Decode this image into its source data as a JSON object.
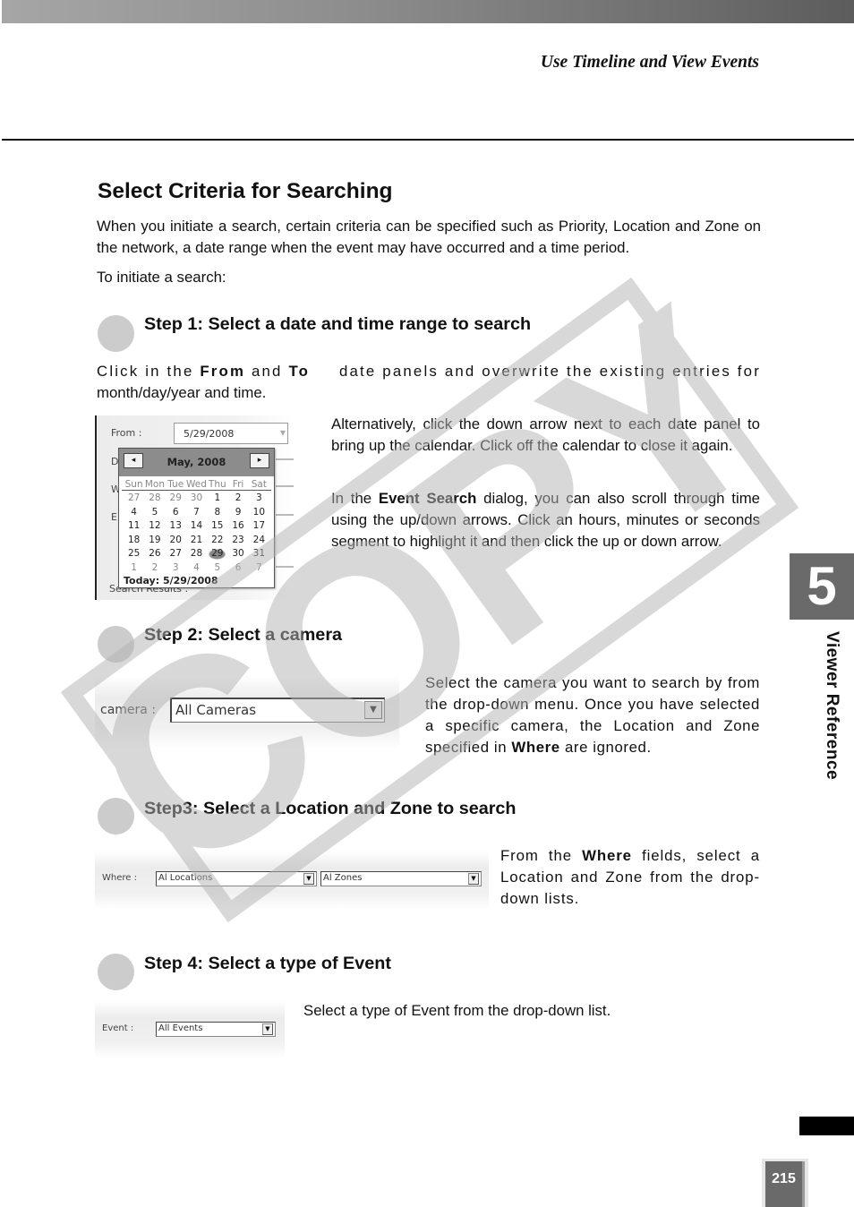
{
  "header": {
    "running_title": "Use Timeline and View Events"
  },
  "section": {
    "title": "Select Criteria for Searching",
    "intro": "When you initiate a search, certain criteria can be specified such as Priority, Location and Zone on the network, a date range when the event may have occurred and a time period.",
    "initiate": "To initiate a search:"
  },
  "steps": [
    {
      "title": "Step 1: Select a date and time range to search",
      "text_a_1": "Click in the ",
      "text_a_bold_1": "From",
      "text_a_2": " and ",
      "text_a_bold_2": "To",
      "text_a_3": " date panels and overwrite the existing entries for month/day/year and time.",
      "text_b": "Alternatively, click the down arrow next to each date panel to bring up the calendar. Click off the calendar to close it again.",
      "text_c_1": "In the ",
      "text_c_bold": "Event Search",
      "text_c_2": " dialog, you can also scroll through time using the up/down arrows. Click an hours, minutes or seconds segment to highlight it and then click the up or down arrow."
    },
    {
      "title": "Step 2: Select a camera",
      "text_1": "Select the camera you want to search by from the drop-down menu. Once you have selected a specific camera, the Location and Zone specified in ",
      "text_bold": "Where",
      "text_2": " are ignored."
    },
    {
      "title": "Step3: Select a Location and Zone to search",
      "text_1": "From the ",
      "text_bold": "Where",
      "text_2": " fields, select a Location and Zone from the drop-down lists."
    },
    {
      "title": "Step 4: Select a type of Event",
      "text": "Select a type of Event from the drop-down list."
    }
  ],
  "calendar_shot": {
    "from_label": "From :",
    "from_value": "5/29/2008",
    "partial_labels": [
      "D",
      "W",
      "E"
    ],
    "search_results_label": "Search Results :",
    "month_title": "May, 2008",
    "prev_icon": "◂",
    "next_icon": "▸",
    "weekdays": [
      "Sun",
      "Mon",
      "Tue",
      "Wed",
      "Thu",
      "Fri",
      "Sat"
    ],
    "weeks": [
      [
        "27",
        "28",
        "29",
        "30",
        "1",
        "2",
        "3"
      ],
      [
        "4",
        "5",
        "6",
        "7",
        "8",
        "9",
        "10"
      ],
      [
        "11",
        "12",
        "13",
        "14",
        "15",
        "16",
        "17"
      ],
      [
        "18",
        "19",
        "20",
        "21",
        "22",
        "23",
        "24"
      ],
      [
        "25",
        "26",
        "27",
        "28",
        "29",
        "30",
        "31"
      ],
      [
        "1",
        "2",
        "3",
        "4",
        "5",
        "6",
        "7"
      ]
    ],
    "selected_day": "29",
    "today_label": "Today: 5/29/2008"
  },
  "camera_shot": {
    "label": "camera :",
    "value": "All Cameras"
  },
  "where_shot": {
    "label": "Where :",
    "location_value": "Al Locations",
    "zone_value": "Al Zones"
  },
  "event_shot": {
    "label": "Event :",
    "value": "All Events"
  },
  "dropdown_icon": "▼",
  "watermark": "COPY",
  "side_tab": {
    "chapter_number": "5",
    "chapter_label": "Viewer Reference"
  },
  "page_number": "215"
}
